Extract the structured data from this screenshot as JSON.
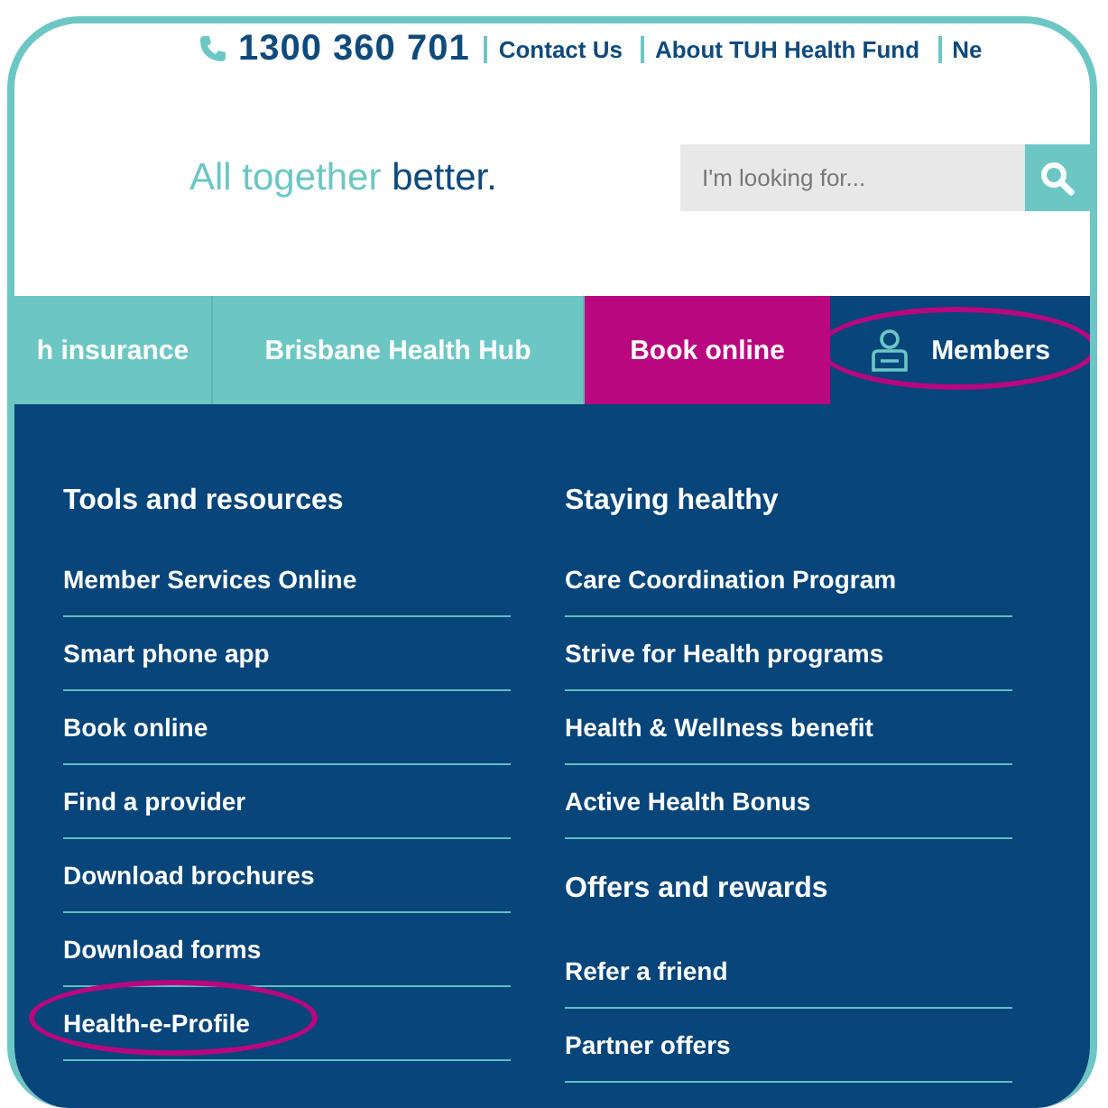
{
  "top_bar": {
    "phone": "1300 360 701",
    "links": [
      "Contact Us",
      "About TUH Health Fund",
      "Ne"
    ]
  },
  "tagline": {
    "light": "All together",
    "bold": "better."
  },
  "search": {
    "placeholder": "I'm looking for..."
  },
  "nav": [
    {
      "label": "h insurance",
      "kind": "section",
      "selected": false,
      "circled": false
    },
    {
      "label": "Brisbane Health Hub",
      "kind": "section",
      "selected": false,
      "circled": false
    },
    {
      "label": "Book online",
      "kind": "promo",
      "selected": false,
      "circled": false
    },
    {
      "label": "Members",
      "kind": "account",
      "selected": true,
      "circled": true
    }
  ],
  "menu_columns": [
    {
      "groups": [
        {
          "heading": "Tools and resources",
          "items": [
            {
              "label": "Member Services Online",
              "circled": false
            },
            {
              "label": "Smart phone app",
              "circled": false
            },
            {
              "label": "Book online",
              "circled": false
            },
            {
              "label": "Find a provider",
              "circled": false
            },
            {
              "label": "Download brochures",
              "circled": false
            },
            {
              "label": "Download forms",
              "circled": false
            },
            {
              "label": "Health-e-Profile",
              "circled": true
            }
          ]
        }
      ]
    },
    {
      "groups": [
        {
          "heading": "Staying healthy",
          "items": [
            {
              "label": "Care Coordination Program",
              "circled": false
            },
            {
              "label": "Strive for Health programs",
              "circled": false
            },
            {
              "label": "Health & Wellness benefit",
              "circled": false
            },
            {
              "label": "Active Health Bonus",
              "circled": false
            }
          ]
        },
        {
          "heading": "Offers and rewards",
          "items": [
            {
              "label": "Refer a friend",
              "circled": false
            },
            {
              "label": "Partner offers",
              "circled": false
            }
          ]
        }
      ]
    }
  ]
}
